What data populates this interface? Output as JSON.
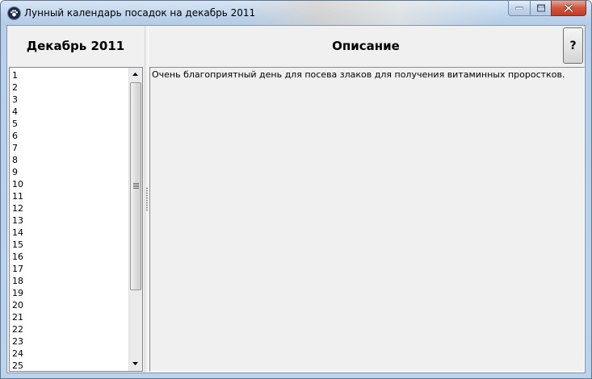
{
  "window": {
    "title": "Лунный календарь посадок на декабрь 2011",
    "icon": "paw-icon",
    "controls": [
      "minimize-icon",
      "maximize-icon",
      "close-icon"
    ]
  },
  "left_panel": {
    "header": "Декабрь 2011",
    "days": [
      "1",
      "2",
      "3",
      "4",
      "5",
      "6",
      "7",
      "8",
      "9",
      "10",
      "11",
      "12",
      "13",
      "14",
      "15",
      "16",
      "17",
      "18",
      "19",
      "20",
      "21",
      "22",
      "23",
      "24",
      "25"
    ]
  },
  "right_panel": {
    "header": "Описание",
    "help_label": "?",
    "description": "Очень благоприятный день для посева злаков для получения витаминных проростков."
  },
  "colors": {
    "titlebar": "#c0d5ec",
    "close_button": "#d2533b",
    "panel_background": "#f0f0f0"
  }
}
